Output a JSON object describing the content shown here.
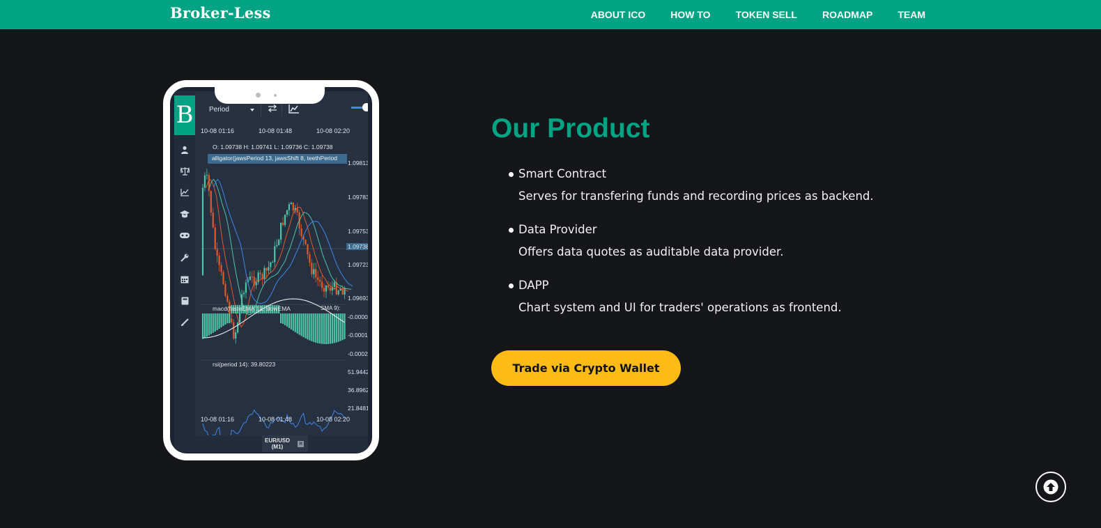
{
  "header": {
    "brand": "Broker-Less",
    "nav": [
      "ABOUT ICO",
      "HOW TO",
      "TOKEN SELL",
      "ROADMAP",
      "TEAM"
    ]
  },
  "phone": {
    "logo_letter": "B",
    "period_label": "Period",
    "times_top": [
      "10-08 01:16",
      "10-08 01:48",
      "10-08 02:20"
    ],
    "times_bottom": [
      "10-08 01:16",
      "10-08 01:48",
      "10-08 02:20"
    ],
    "ohlc": "O: 1.09738 H: 1.09741 L: 1.09736 C: 1.09738",
    "indicator": "alligator(jawsPeriod 13, jawsShift 8, teethPeriod",
    "price_axis": [
      "1.09813",
      "1.09783",
      "1.09753",
      "1.09738",
      "1.09723",
      "1.09693"
    ],
    "macd_label": "macd(fasteEMA 12, slowEMA",
    "macd_label_tail": "SMA 9):",
    "macd_axis": [
      "-0.0000",
      "-0.0001",
      "-0.0002"
    ],
    "rsi_label": "rsi(period 14): 39.80223",
    "rsi_axis": [
      "51.9442",
      "36.8962",
      "21.8481"
    ],
    "symbol_line1": "EUR/USD",
    "symbol_line2": "(M1)",
    "colors": {
      "accent": "#00a383",
      "bull": "#4fc4a6",
      "bear": "#e05a2b",
      "line_blue": "#3d88e8"
    }
  },
  "product": {
    "title": "Our Product",
    "features": [
      {
        "name": "Smart Contract",
        "desc": "Serves for transfering funds and recording prices as backend."
      },
      {
        "name": "Data Provider",
        "desc": "Offers data quotes as auditable data provider."
      },
      {
        "name": "DAPP",
        "desc": "Chart system and UI for traders' operations as frontend."
      }
    ],
    "cta": "Trade via Crypto Wallet"
  },
  "colors": {
    "nav_bg": "#00a383",
    "page_bg": "#15161a",
    "title": "#00a383",
    "cta_bg": "#fdbb16"
  }
}
